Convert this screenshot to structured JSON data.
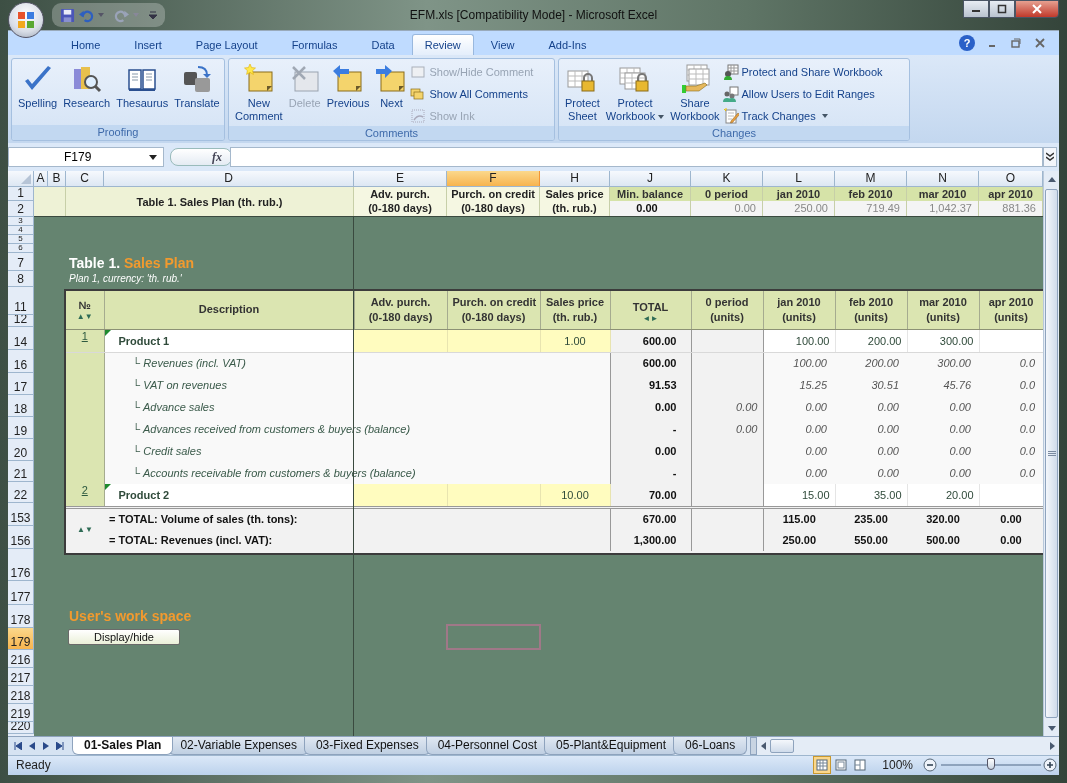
{
  "window": {
    "title": "EFM.xls  [Compatibility Mode] - Microsoft Excel"
  },
  "ribbon_tabs": [
    {
      "label": "Home",
      "selected": false
    },
    {
      "label": "Insert",
      "selected": false
    },
    {
      "label": "Page Layout",
      "selected": false
    },
    {
      "label": "Formulas",
      "selected": false
    },
    {
      "label": "Data",
      "selected": false
    },
    {
      "label": "Review",
      "selected": true
    },
    {
      "label": "View",
      "selected": false
    },
    {
      "label": "Add-Ins",
      "selected": false
    }
  ],
  "help_glyph": "?",
  "ribbon_groups": [
    {
      "label": "Proofing",
      "buttons": [
        {
          "label": "Spelling",
          "disabled": false,
          "dropdown": false
        },
        {
          "label": "Research",
          "disabled": false,
          "dropdown": false
        },
        {
          "label": "Thesaurus",
          "disabled": false,
          "dropdown": false
        },
        {
          "label": "Translate",
          "disabled": false,
          "dropdown": false
        }
      ]
    },
    {
      "label": "Comments",
      "buttons": [
        {
          "label": "New\nComment",
          "disabled": false,
          "dropdown": false
        },
        {
          "label": "Delete",
          "disabled": true,
          "dropdown": false
        },
        {
          "label": "Previous",
          "disabled": false,
          "dropdown": false
        },
        {
          "label": "Next",
          "disabled": false,
          "dropdown": false
        }
      ],
      "small_buttons": [
        {
          "label": "Show/Hide Comment",
          "disabled": true,
          "dropdown": false
        },
        {
          "label": "Show All Comments",
          "disabled": false,
          "dropdown": false
        },
        {
          "label": "Show Ink",
          "disabled": true,
          "dropdown": false
        }
      ]
    },
    {
      "label": "Changes",
      "buttons": [
        {
          "label": "Protect\nSheet",
          "disabled": false,
          "dropdown": false
        },
        {
          "label": "Protect\nWorkbook",
          "disabled": false,
          "dropdown": true
        },
        {
          "label": "Share\nWorkbook",
          "disabled": false,
          "dropdown": false
        }
      ],
      "small_buttons": [
        {
          "label": "Protect and Share Workbook",
          "disabled": false,
          "dropdown": false
        },
        {
          "label": "Allow Users to Edit Ranges",
          "disabled": false,
          "dropdown": false
        },
        {
          "label": "Track Changes",
          "disabled": false,
          "dropdown": true
        }
      ]
    }
  ],
  "formula_bar": {
    "name_box": "F179",
    "function_label": "fx"
  },
  "columns": [
    {
      "label": "A",
      "selected": false
    },
    {
      "label": "B",
      "selected": false
    },
    {
      "label": "C",
      "selected": false
    },
    {
      "label": "D",
      "selected": false
    },
    {
      "label": "E",
      "selected": false
    },
    {
      "label": "F",
      "selected": true
    },
    {
      "label": "H",
      "selected": false
    },
    {
      "label": "J",
      "selected": false
    },
    {
      "label": "K",
      "selected": false
    },
    {
      "label": "L",
      "selected": false
    },
    {
      "label": "M",
      "selected": false
    },
    {
      "label": "N",
      "selected": false
    },
    {
      "label": "O",
      "selected": false
    }
  ],
  "row_numbers": [
    {
      "label": "1",
      "selected": false
    },
    {
      "label": "2",
      "selected": false
    },
    {
      "label": "3",
      "selected": false
    },
    {
      "label": "4",
      "selected": false
    },
    {
      "label": "5",
      "selected": false
    },
    {
      "label": "6",
      "selected": false
    },
    {
      "label": "7",
      "selected": false
    },
    {
      "label": "8",
      "selected": false
    },
    {
      "label": "11",
      "selected": false
    },
    {
      "label": "12",
      "selected": false
    },
    {
      "label": "14",
      "selected": false
    },
    {
      "label": "16",
      "selected": false
    },
    {
      "label": "17",
      "selected": false
    },
    {
      "label": "18",
      "selected": false
    },
    {
      "label": "19",
      "selected": false
    },
    {
      "label": "20",
      "selected": false
    },
    {
      "label": "21",
      "selected": false
    },
    {
      "label": "22",
      "selected": false
    },
    {
      "label": "153",
      "selected": false
    },
    {
      "label": "156",
      "selected": false
    },
    {
      "label": "176",
      "selected": false
    },
    {
      "label": "177",
      "selected": false
    },
    {
      "label": "178",
      "selected": false
    },
    {
      "label": "179",
      "selected": true
    },
    {
      "label": "216",
      "selected": false
    },
    {
      "label": "217",
      "selected": false
    },
    {
      "label": "218",
      "selected": false
    },
    {
      "label": "219",
      "selected": false
    },
    {
      "label": "220",
      "selected": false
    }
  ],
  "frozen_header": {
    "title": "Table 1. Sales Plan (th. rub.)",
    "inputs": [
      {
        "line_1": "Adv. purch.",
        "line_2": "(0-180 days)"
      },
      {
        "line_1": "Purch. on credit",
        "line_2": "(0-180 days)"
      },
      {
        "line_1": "Sales price",
        "line_2": "(th. rub.)"
      }
    ],
    "periods": [
      {
        "label": "Min. balance",
        "value": "0.00",
        "bold": true
      },
      {
        "label": "0 period",
        "value": "0.00",
        "bold": false
      },
      {
        "label": "jan 2010",
        "value": "250.00",
        "bold": false
      },
      {
        "label": "feb 2010",
        "value": "719.49",
        "bold": false
      },
      {
        "label": "mar 2010",
        "value": "1,042.37",
        "bold": false
      },
      {
        "label": "apr 2010",
        "value": "881.36",
        "bold": false
      }
    ]
  },
  "sales_plan": {
    "title": "Table 1.",
    "title_accent": "Sales Plan",
    "subtitle": "Plan 1, currency: 'th. rub.'",
    "header": {
      "number": "№",
      "sort_arrows": "▲▼",
      "description": "Description",
      "inputs": [
        {
          "line_1": "Adv. purch.",
          "line_2": "(0-180 days)"
        },
        {
          "line_1": "Purch. on credit",
          "line_2": "(0-180 days)"
        },
        {
          "line_1": "Sales price",
          "line_2": "(th. rub.)"
        }
      ],
      "total": "TOTAL",
      "total_arrows": "◄►",
      "periods": [
        {
          "line_1": "0 period",
          "line_2": "(units)"
        },
        {
          "line_1": "jan 2010",
          "line_2": "(units)"
        },
        {
          "line_1": "feb 2010",
          "line_2": "(units)"
        },
        {
          "line_1": "mar 2010",
          "line_2": "(units)"
        },
        {
          "line_1": "apr 2010",
          "line_2": "(units)"
        }
      ]
    },
    "rows": [
      {
        "kind": "product",
        "number": "1",
        "label": "Product 1",
        "price": "1.00",
        "total": "600.00",
        "months": [
          "100.00",
          "200.00",
          "300.00"
        ]
      },
      {
        "kind": "detail",
        "label": "└ Revenues (incl. VAT)",
        "total": "600.00",
        "months": [
          "100.00",
          "200.00",
          "300.00",
          "0.0"
        ]
      },
      {
        "kind": "detail",
        "label": "└ VAT on revenues",
        "total": "91.53",
        "months": [
          "15.25",
          "30.51",
          "45.76",
          "0.0"
        ]
      },
      {
        "kind": "detail",
        "label": "└ Advance sales",
        "total": "0.00",
        "zero_period": "0.00",
        "months": [
          "0.00",
          "0.00",
          "0.00",
          "0.0"
        ]
      },
      {
        "kind": "detail",
        "label": "└ Advances received from customers & buyers (balance)",
        "total": "-",
        "zero_period": "0.00",
        "months": [
          "0.00",
          "0.00",
          "0.00",
          "0.0"
        ]
      },
      {
        "kind": "detail",
        "label": "└ Credit sales",
        "total": "0.00",
        "months": [
          "0.00",
          "0.00",
          "0.00",
          "0.0"
        ]
      },
      {
        "kind": "detail",
        "label": "└ Accounts receivable from customers & buyers (balance)",
        "total": "-",
        "months": [
          "0.00",
          "0.00",
          "0.00",
          "0.0"
        ]
      },
      {
        "kind": "product",
        "number": "2",
        "label": "Product 2",
        "price": "10.00",
        "total": "70.00",
        "months": [
          "15.00",
          "35.00",
          "20.00"
        ]
      }
    ],
    "totals": {
      "sort_arrows": "▲▼",
      "rows": [
        {
          "label": "= TOTAL: Volume of sales (th. tons):",
          "total": "670.00",
          "months": [
            "115.00",
            "235.00",
            "320.00",
            "0.00"
          ]
        },
        {
          "label": "= TOTAL: Revenues (incl. VAT):",
          "total": "1,300.00",
          "months": [
            "250.00",
            "550.00",
            "500.00",
            "0.00"
          ]
        }
      ]
    }
  },
  "workspace": {
    "label": "User's work space",
    "button": "Display/hide"
  },
  "sheet_tabs": [
    {
      "label": "01-Sales Plan",
      "selected": true
    },
    {
      "label": "02-Variable Expenses",
      "selected": false
    },
    {
      "label": "03-Fixed Expenses",
      "selected": false
    },
    {
      "label": "04-Personnel Cost",
      "selected": false
    },
    {
      "label": "05-Plant&Equipment",
      "selected": false
    },
    {
      "label": "06-Loans",
      "selected": false
    }
  ],
  "status_bar": {
    "text": "Ready",
    "views": [
      {
        "selected": true
      },
      {
        "selected": false
      },
      {
        "selected": false
      }
    ],
    "zoom": "100%",
    "zoom_slider": {
      "level": 0.5
    }
  }
}
